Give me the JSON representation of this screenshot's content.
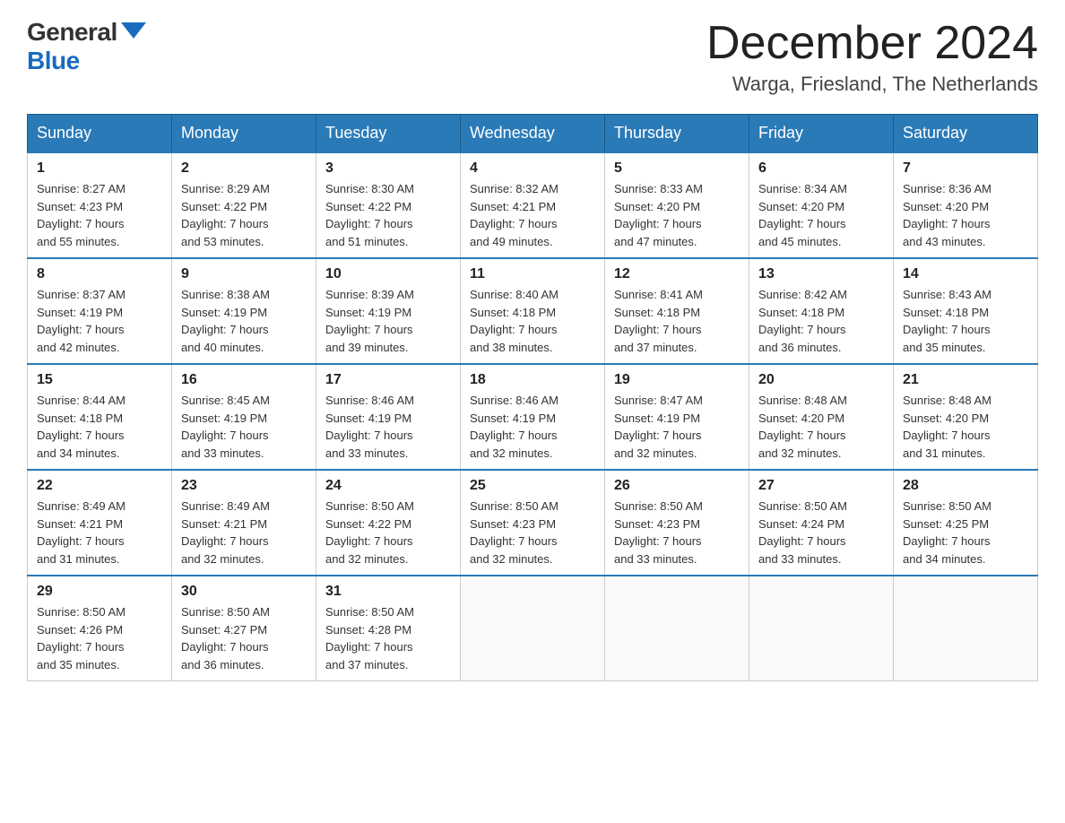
{
  "header": {
    "logo_general": "General",
    "logo_blue": "Blue",
    "month_title": "December 2024",
    "location": "Warga, Friesland, The Netherlands"
  },
  "weekdays": [
    "Sunday",
    "Monday",
    "Tuesday",
    "Wednesday",
    "Thursday",
    "Friday",
    "Saturday"
  ],
  "weeks": [
    [
      {
        "day": "1",
        "sunrise": "8:27 AM",
        "sunset": "4:23 PM",
        "daylight": "7 hours and 55 minutes."
      },
      {
        "day": "2",
        "sunrise": "8:29 AM",
        "sunset": "4:22 PM",
        "daylight": "7 hours and 53 minutes."
      },
      {
        "day": "3",
        "sunrise": "8:30 AM",
        "sunset": "4:22 PM",
        "daylight": "7 hours and 51 minutes."
      },
      {
        "day": "4",
        "sunrise": "8:32 AM",
        "sunset": "4:21 PM",
        "daylight": "7 hours and 49 minutes."
      },
      {
        "day": "5",
        "sunrise": "8:33 AM",
        "sunset": "4:20 PM",
        "daylight": "7 hours and 47 minutes."
      },
      {
        "day": "6",
        "sunrise": "8:34 AM",
        "sunset": "4:20 PM",
        "daylight": "7 hours and 45 minutes."
      },
      {
        "day": "7",
        "sunrise": "8:36 AM",
        "sunset": "4:20 PM",
        "daylight": "7 hours and 43 minutes."
      }
    ],
    [
      {
        "day": "8",
        "sunrise": "8:37 AM",
        "sunset": "4:19 PM",
        "daylight": "7 hours and 42 minutes."
      },
      {
        "day": "9",
        "sunrise": "8:38 AM",
        "sunset": "4:19 PM",
        "daylight": "7 hours and 40 minutes."
      },
      {
        "day": "10",
        "sunrise": "8:39 AM",
        "sunset": "4:19 PM",
        "daylight": "7 hours and 39 minutes."
      },
      {
        "day": "11",
        "sunrise": "8:40 AM",
        "sunset": "4:18 PM",
        "daylight": "7 hours and 38 minutes."
      },
      {
        "day": "12",
        "sunrise": "8:41 AM",
        "sunset": "4:18 PM",
        "daylight": "7 hours and 37 minutes."
      },
      {
        "day": "13",
        "sunrise": "8:42 AM",
        "sunset": "4:18 PM",
        "daylight": "7 hours and 36 minutes."
      },
      {
        "day": "14",
        "sunrise": "8:43 AM",
        "sunset": "4:18 PM",
        "daylight": "7 hours and 35 minutes."
      }
    ],
    [
      {
        "day": "15",
        "sunrise": "8:44 AM",
        "sunset": "4:18 PM",
        "daylight": "7 hours and 34 minutes."
      },
      {
        "day": "16",
        "sunrise": "8:45 AM",
        "sunset": "4:19 PM",
        "daylight": "7 hours and 33 minutes."
      },
      {
        "day": "17",
        "sunrise": "8:46 AM",
        "sunset": "4:19 PM",
        "daylight": "7 hours and 33 minutes."
      },
      {
        "day": "18",
        "sunrise": "8:46 AM",
        "sunset": "4:19 PM",
        "daylight": "7 hours and 32 minutes."
      },
      {
        "day": "19",
        "sunrise": "8:47 AM",
        "sunset": "4:19 PM",
        "daylight": "7 hours and 32 minutes."
      },
      {
        "day": "20",
        "sunrise": "8:48 AM",
        "sunset": "4:20 PM",
        "daylight": "7 hours and 32 minutes."
      },
      {
        "day": "21",
        "sunrise": "8:48 AM",
        "sunset": "4:20 PM",
        "daylight": "7 hours and 31 minutes."
      }
    ],
    [
      {
        "day": "22",
        "sunrise": "8:49 AM",
        "sunset": "4:21 PM",
        "daylight": "7 hours and 31 minutes."
      },
      {
        "day": "23",
        "sunrise": "8:49 AM",
        "sunset": "4:21 PM",
        "daylight": "7 hours and 32 minutes."
      },
      {
        "day": "24",
        "sunrise": "8:50 AM",
        "sunset": "4:22 PM",
        "daylight": "7 hours and 32 minutes."
      },
      {
        "day": "25",
        "sunrise": "8:50 AM",
        "sunset": "4:23 PM",
        "daylight": "7 hours and 32 minutes."
      },
      {
        "day": "26",
        "sunrise": "8:50 AM",
        "sunset": "4:23 PM",
        "daylight": "7 hours and 33 minutes."
      },
      {
        "day": "27",
        "sunrise": "8:50 AM",
        "sunset": "4:24 PM",
        "daylight": "7 hours and 33 minutes."
      },
      {
        "day": "28",
        "sunrise": "8:50 AM",
        "sunset": "4:25 PM",
        "daylight": "7 hours and 34 minutes."
      }
    ],
    [
      {
        "day": "29",
        "sunrise": "8:50 AM",
        "sunset": "4:26 PM",
        "daylight": "7 hours and 35 minutes."
      },
      {
        "day": "30",
        "sunrise": "8:50 AM",
        "sunset": "4:27 PM",
        "daylight": "7 hours and 36 minutes."
      },
      {
        "day": "31",
        "sunrise": "8:50 AM",
        "sunset": "4:28 PM",
        "daylight": "7 hours and 37 minutes."
      },
      null,
      null,
      null,
      null
    ]
  ],
  "labels": {
    "sunrise": "Sunrise:",
    "sunset": "Sunset:",
    "daylight": "Daylight:"
  }
}
